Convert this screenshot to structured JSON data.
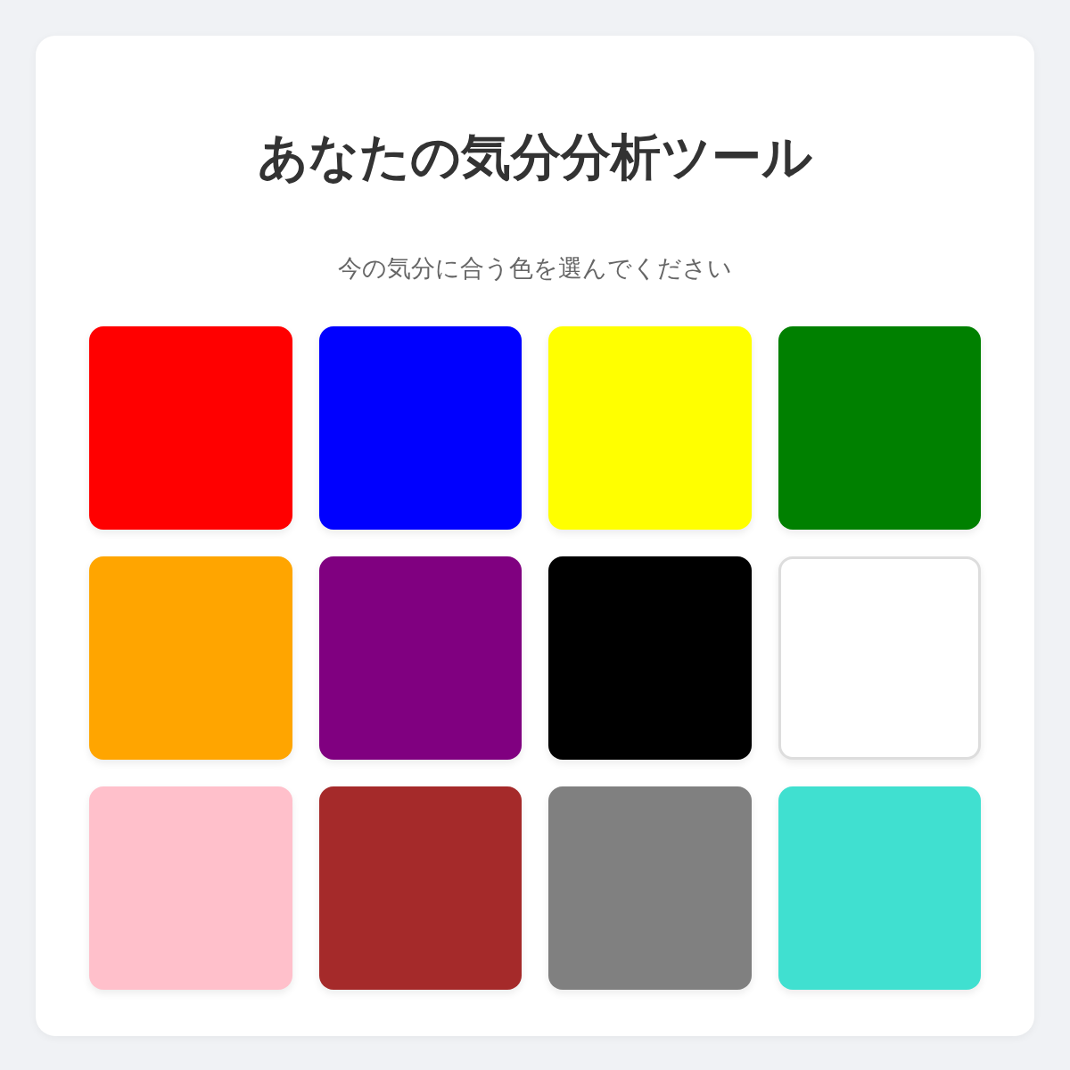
{
  "title": "あなたの気分分析ツール",
  "subtitle": "今の気分に合う色を選んでください",
  "colors": [
    {
      "color": "#ff0000"
    },
    {
      "color": "#0000ff"
    },
    {
      "color": "#ffff00"
    },
    {
      "color": "#008000"
    },
    {
      "color": "#ffa500"
    },
    {
      "color": "#800080"
    },
    {
      "color": "#000000"
    },
    {
      "color": "#ffffff"
    },
    {
      "color": "#ffc0cb"
    },
    {
      "color": "#a52a2a"
    },
    {
      "color": "#808080"
    },
    {
      "color": "#40e0d0"
    }
  ]
}
